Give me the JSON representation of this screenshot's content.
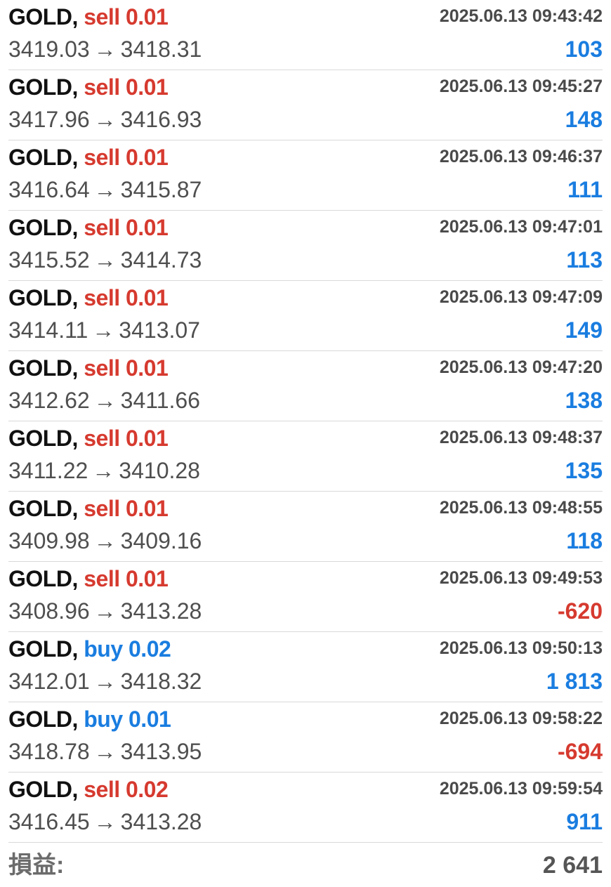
{
  "trades": [
    {
      "symbol": "GOLD",
      "sep": ",",
      "direction": "sell 0.01",
      "side": "sell",
      "time": "2025.06.13 09:43:42",
      "open": "3419.03",
      "arrow": "→",
      "close": "3418.31",
      "profit": "103",
      "profit_sign": "pos"
    },
    {
      "symbol": "GOLD",
      "sep": ",",
      "direction": "sell 0.01",
      "side": "sell",
      "time": "2025.06.13 09:45:27",
      "open": "3417.96",
      "arrow": "→",
      "close": "3416.93",
      "profit": "148",
      "profit_sign": "pos"
    },
    {
      "symbol": "GOLD",
      "sep": ",",
      "direction": "sell 0.01",
      "side": "sell",
      "time": "2025.06.13 09:46:37",
      "open": "3416.64",
      "arrow": "→",
      "close": "3415.87",
      "profit": "111",
      "profit_sign": "pos"
    },
    {
      "symbol": "GOLD",
      "sep": ",",
      "direction": "sell 0.01",
      "side": "sell",
      "time": "2025.06.13 09:47:01",
      "open": "3415.52",
      "arrow": "→",
      "close": "3414.73",
      "profit": "113",
      "profit_sign": "pos"
    },
    {
      "symbol": "GOLD",
      "sep": ",",
      "direction": "sell 0.01",
      "side": "sell",
      "time": "2025.06.13 09:47:09",
      "open": "3414.11",
      "arrow": "→",
      "close": "3413.07",
      "profit": "149",
      "profit_sign": "pos"
    },
    {
      "symbol": "GOLD",
      "sep": ",",
      "direction": "sell 0.01",
      "side": "sell",
      "time": "2025.06.13 09:47:20",
      "open": "3412.62",
      "arrow": "→",
      "close": "3411.66",
      "profit": "138",
      "profit_sign": "pos"
    },
    {
      "symbol": "GOLD",
      "sep": ",",
      "direction": "sell 0.01",
      "side": "sell",
      "time": "2025.06.13 09:48:37",
      "open": "3411.22",
      "arrow": "→",
      "close": "3410.28",
      "profit": "135",
      "profit_sign": "pos"
    },
    {
      "symbol": "GOLD",
      "sep": ",",
      "direction": "sell 0.01",
      "side": "sell",
      "time": "2025.06.13 09:48:55",
      "open": "3409.98",
      "arrow": "→",
      "close": "3409.16",
      "profit": "118",
      "profit_sign": "pos"
    },
    {
      "symbol": "GOLD",
      "sep": ",",
      "direction": "sell 0.01",
      "side": "sell",
      "time": "2025.06.13 09:49:53",
      "open": "3408.96",
      "arrow": "→",
      "close": "3413.28",
      "profit": "-620",
      "profit_sign": "neg"
    },
    {
      "symbol": "GOLD",
      "sep": ",",
      "direction": "buy 0.02",
      "side": "buy",
      "time": "2025.06.13 09:50:13",
      "open": "3412.01",
      "arrow": "→",
      "close": "3418.32",
      "profit": "1 813",
      "profit_sign": "pos"
    },
    {
      "symbol": "GOLD",
      "sep": ",",
      "direction": "buy 0.01",
      "side": "buy",
      "time": "2025.06.13 09:58:22",
      "open": "3418.78",
      "arrow": "→",
      "close": "3413.95",
      "profit": "-694",
      "profit_sign": "neg"
    },
    {
      "symbol": "GOLD",
      "sep": ",",
      "direction": "sell 0.02",
      "side": "sell",
      "time": "2025.06.13 09:59:54",
      "open": "3416.45",
      "arrow": "→",
      "close": "3413.28",
      "profit": "911",
      "profit_sign": "pos"
    }
  ],
  "total": {
    "label": "損益:",
    "value": "2 641"
  },
  "colors": {
    "sell": "#d63a2f",
    "buy": "#1a7de0",
    "profit_positive": "#1a7de0",
    "profit_negative": "#d63a2f"
  }
}
